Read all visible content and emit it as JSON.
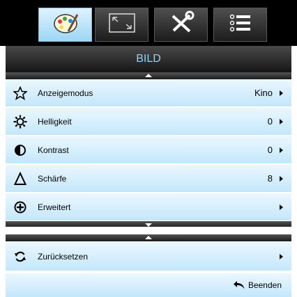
{
  "tabs": [
    {
      "icon": "palette-icon",
      "active": true
    },
    {
      "icon": "fullscreen-icon",
      "active": false
    },
    {
      "icon": "tools-icon",
      "active": false
    },
    {
      "icon": "list-icon",
      "active": false
    }
  ],
  "section": {
    "title": "BILD"
  },
  "items": [
    {
      "icon": "star-icon",
      "label": "Anzeigemodus",
      "value": "Kino"
    },
    {
      "icon": "brightness-icon",
      "label": "Helligkeit",
      "value": "0"
    },
    {
      "icon": "contrast-icon",
      "label": "Kontrast",
      "value": "0"
    },
    {
      "icon": "sharpness-icon",
      "label": "Schärfe",
      "value": "8"
    },
    {
      "icon": "advanced-icon",
      "label": "Erweitert",
      "value": ""
    }
  ],
  "reset": {
    "icon": "reset-icon",
    "label": "Zurücksetzen"
  },
  "exit": {
    "icon": "return-icon",
    "label": "Beenden"
  },
  "colors": {
    "accent": "#8fd3ff",
    "row_top": "#eaf7ff",
    "row_bottom": "#c4e7fb",
    "bar_dark": "#000000"
  }
}
